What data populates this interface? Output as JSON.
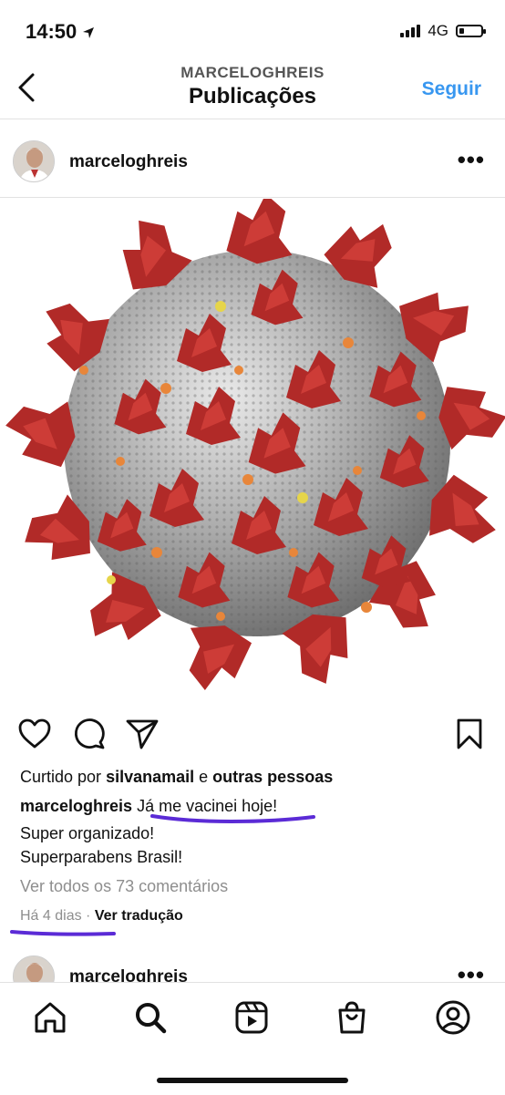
{
  "status_bar": {
    "time": "14:50",
    "network": "4G"
  },
  "header": {
    "subtitle": "MARCELOGHREIS",
    "title": "Publicações",
    "follow_label": "Seguir"
  },
  "post": {
    "username": "marceloghreis",
    "liked_prefix": "Curtido por",
    "liked_user": "silvanamail",
    "liked_and": "e",
    "liked_others": "outras pessoas",
    "caption_user": "marceloghreis",
    "caption_lines": [
      "Já me vacinei hoje!",
      "Super organizado!",
      "Superparabens Brasil!"
    ],
    "view_comments": "Ver todos os 73 comentários",
    "time_ago": "Há 4 dias",
    "separator": "·",
    "translate": "Ver tradução"
  },
  "next_post": {
    "username": "marceloghreis"
  },
  "annotations": {
    "underline_color": "#5b2bd6"
  },
  "tabs": [
    "home-icon",
    "search-icon",
    "reels-icon",
    "shop-icon",
    "profile-icon"
  ]
}
